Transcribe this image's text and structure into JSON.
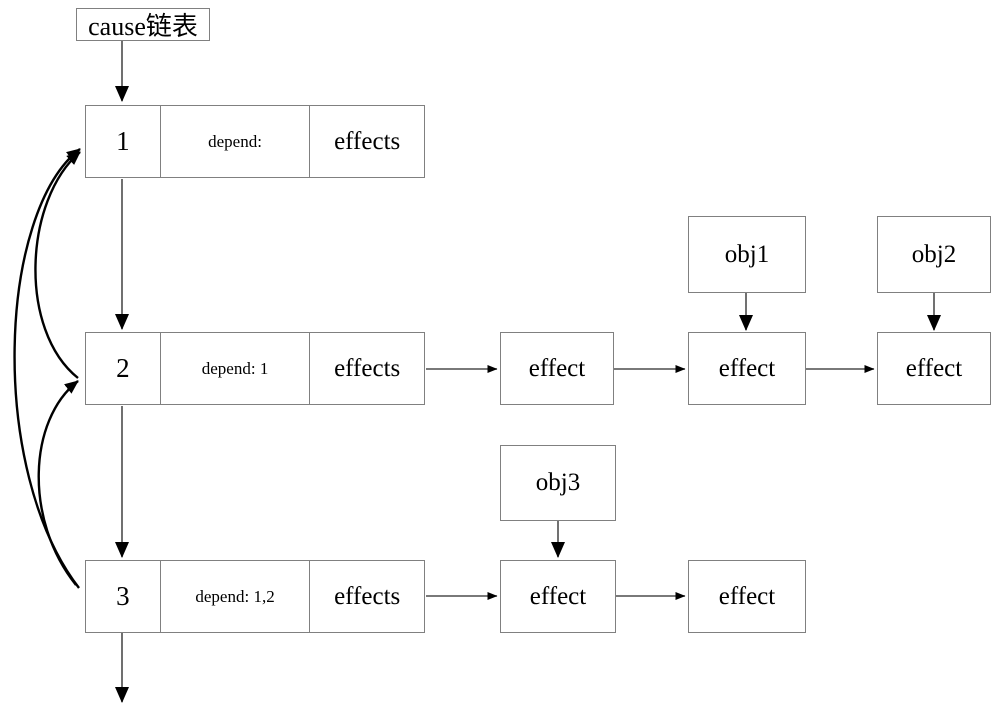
{
  "diagram": {
    "title_node": {
      "label": "cause链表"
    },
    "cause_nodes": [
      {
        "id": "1",
        "depend": "depend:",
        "effects": "effects"
      },
      {
        "id": "2",
        "depend": "depend: 1",
        "effects": "effects"
      },
      {
        "id": "3",
        "depend": "depend: 1,2",
        "effects": "effects"
      }
    ],
    "row2_effects": [
      {
        "label": "effect"
      },
      {
        "label": "effect"
      },
      {
        "label": "effect"
      }
    ],
    "row3_effects": [
      {
        "label": "effect"
      },
      {
        "label": "effect"
      }
    ],
    "objects": [
      {
        "label": "obj1"
      },
      {
        "label": "obj2"
      },
      {
        "label": "obj3"
      }
    ],
    "colors": {
      "box_border": "#808080",
      "line": "#4d4d4d",
      "curve": "#000000",
      "text": "#000000",
      "background": "#ffffff"
    }
  }
}
